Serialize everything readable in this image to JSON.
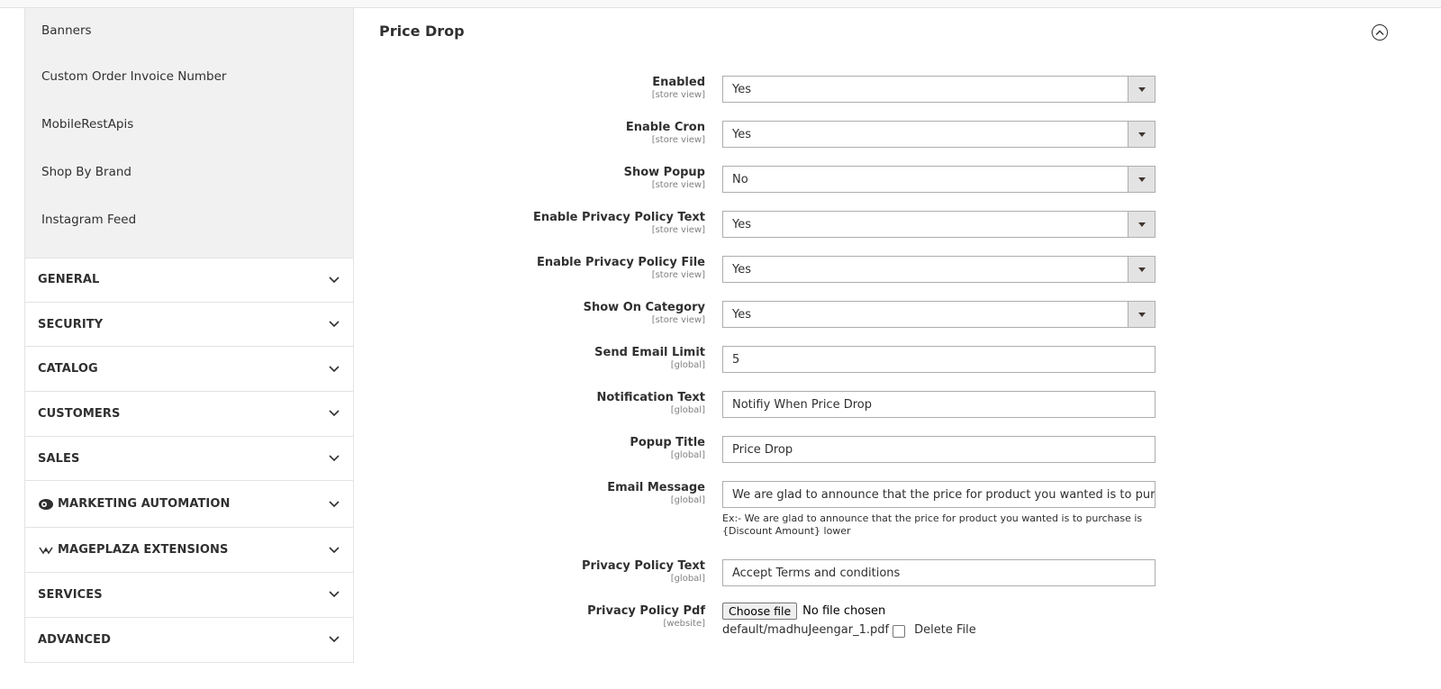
{
  "sidebar": {
    "sub_items": [
      "Banners",
      "Custom Order Invoice Number",
      "MobileRestApis",
      "Shop By Brand",
      "Instagram Feed"
    ],
    "sections": [
      {
        "label": "GENERAL",
        "icon": ""
      },
      {
        "label": "SECURITY",
        "icon": ""
      },
      {
        "label": "CATALOG",
        "icon": ""
      },
      {
        "label": "CUSTOMERS",
        "icon": ""
      },
      {
        "label": "SALES",
        "icon": ""
      },
      {
        "label": "MARKETING AUTOMATION",
        "icon": "marketing-automation-icon"
      },
      {
        "label": "MAGEPLAZA EXTENSIONS",
        "icon": "mageplaza-icon"
      },
      {
        "label": "SERVICES",
        "icon": ""
      },
      {
        "label": "ADVANCED",
        "icon": ""
      }
    ]
  },
  "panel": {
    "title": "Price Drop"
  },
  "fields": {
    "enabled": {
      "label": "Enabled",
      "scope": "[store view]",
      "value": "Yes"
    },
    "enable_cron": {
      "label": "Enable Cron",
      "scope": "[store view]",
      "value": "Yes"
    },
    "show_popup": {
      "label": "Show Popup",
      "scope": "[store view]",
      "value": "No"
    },
    "enable_pp_text": {
      "label": "Enable Privacy Policy Text",
      "scope": "[store view]",
      "value": "Yes"
    },
    "enable_pp_file": {
      "label": "Enable Privacy Policy File",
      "scope": "[store view]",
      "value": "Yes"
    },
    "show_on_category": {
      "label": "Show On Category",
      "scope": "[store view]",
      "value": "Yes"
    },
    "send_email_limit": {
      "label": "Send Email Limit",
      "scope": "[global]",
      "value": "5"
    },
    "notification_text": {
      "label": "Notification Text",
      "scope": "[global]",
      "value": "Notifiy When Price Drop"
    },
    "popup_title": {
      "label": "Popup Title",
      "scope": "[global]",
      "value": "Price Drop"
    },
    "email_message": {
      "label": "Email Message",
      "scope": "[global]",
      "value": "We are glad to announce that the price for product you wanted is to purchase is {Discount Amount} lower",
      "note": "Ex:- We are glad to announce that the price for product you wanted is to purchase is {Discount Amount} lower"
    },
    "pp_text": {
      "label": "Privacy Policy Text",
      "scope": "[global]",
      "value": "Accept Terms and conditions"
    },
    "pp_pdf": {
      "label": "Privacy Policy Pdf",
      "scope": "[website]",
      "button": "Choose file",
      "status": "No file chosen",
      "current_file": "default/madhuJeengar_1.pdf",
      "delete_label": "Delete File"
    }
  }
}
